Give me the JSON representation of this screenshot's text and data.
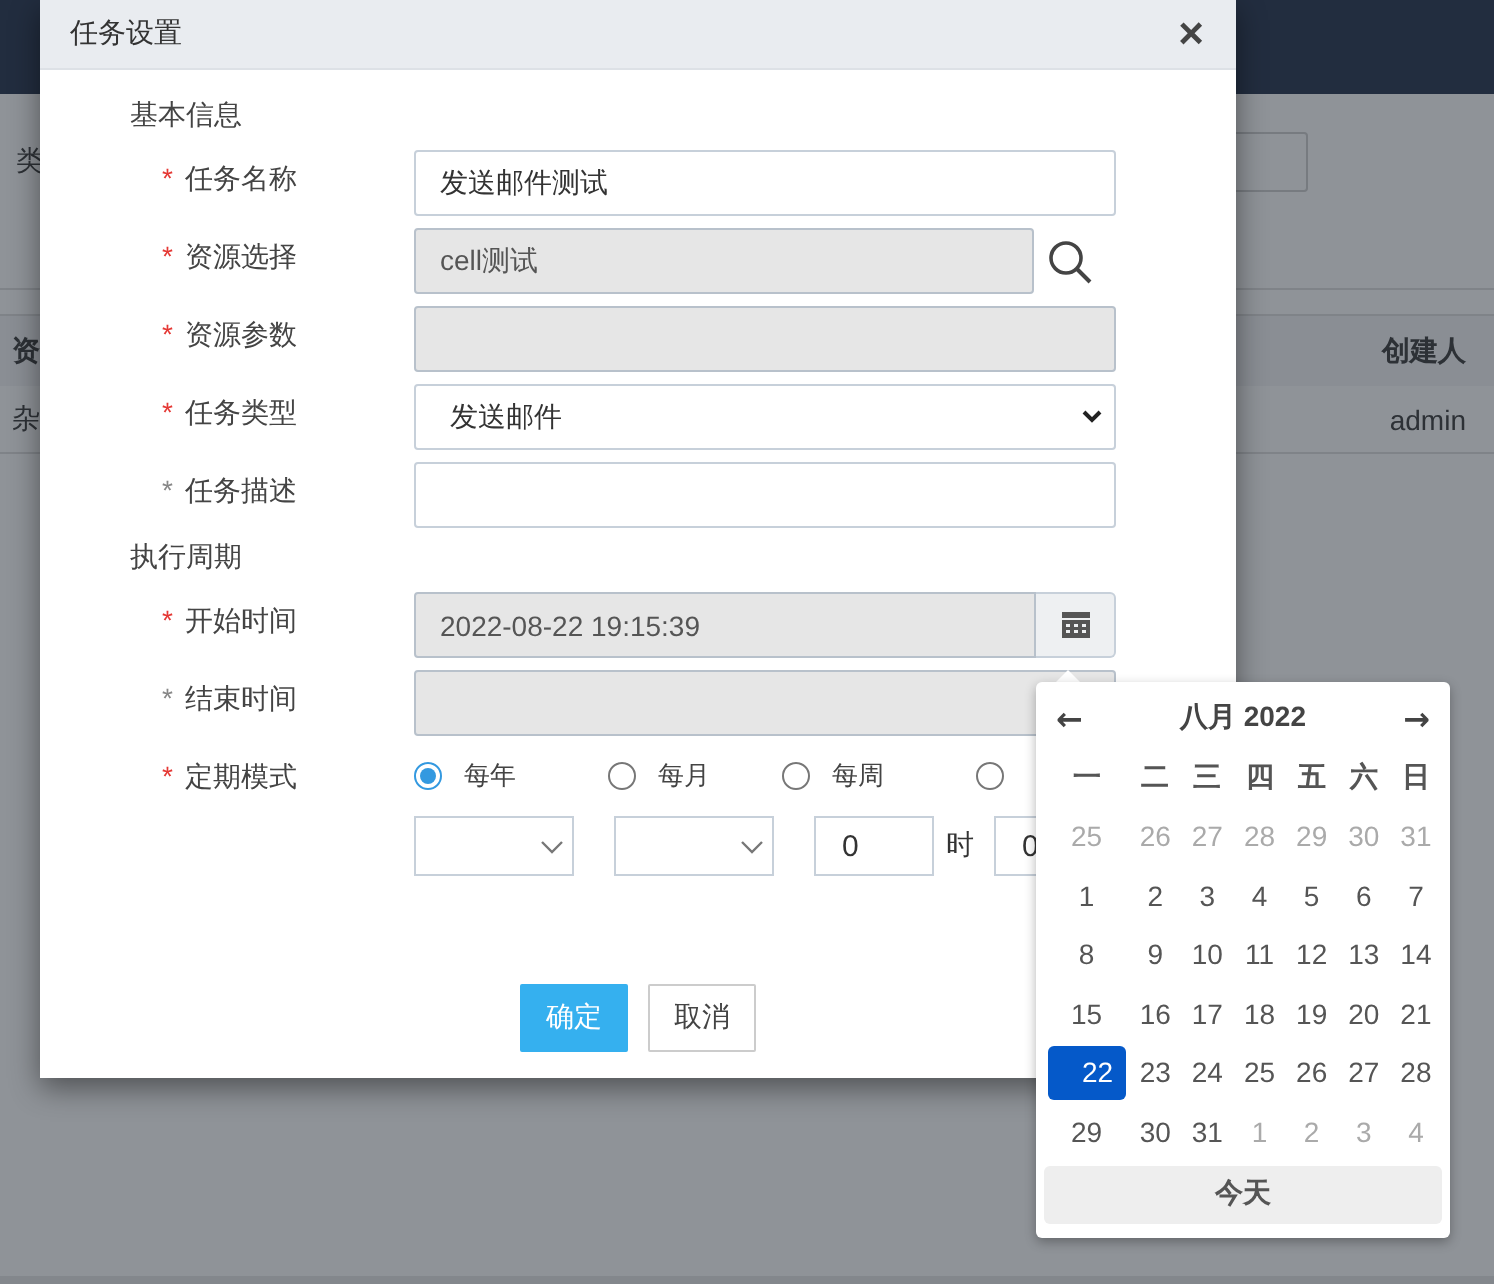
{
  "background_page": {
    "filter_labels": [
      "类"
    ],
    "table": {
      "columns": [
        "资",
        "创建人"
      ],
      "rows": [
        [
          "杂",
          "admin"
        ]
      ]
    }
  },
  "dialog": {
    "title": "任务设置",
    "close": "×",
    "sections": [
      {
        "title": "基本信息",
        "fields": [
          {
            "marker": "*",
            "label": "任务名称",
            "required": true,
            "kind": "text",
            "value": "发送邮件测试",
            "disabled": false
          },
          {
            "marker": "*",
            "label": "资源选择",
            "required": true,
            "kind": "lookup",
            "value": "cell测试",
            "disabled": true
          },
          {
            "marker": "*",
            "label": "资源参数",
            "required": true,
            "kind": "text",
            "disabled": true
          },
          {
            "marker": "*",
            "label": "任务类型",
            "required": true,
            "kind": "select",
            "value": "发送邮件",
            "disabled": false
          },
          {
            "marker": "*",
            "label": "任务描述",
            "required": false,
            "kind": "text",
            "disabled": false
          }
        ]
      },
      {
        "title": "执行周期",
        "fields": [
          {
            "marker": "*",
            "label": "开始时间",
            "required": true,
            "kind": "date",
            "value": "2022-08-22 19:15:39",
            "disabled": true
          },
          {
            "marker": "*",
            "label": "结束时间",
            "required": false,
            "kind": "text",
            "disabled": true
          },
          {
            "marker": "*",
            "label": "定期模式",
            "required": true,
            "kind": "radio",
            "options": [
              {
                "label": "每年",
                "selected": true
              },
              {
                "label": "每月",
                "selected": false
              },
              {
                "label": "每周",
                "selected": false
              },
              {
                "selected": false
              }
            ]
          }
        ]
      }
    ],
    "schedule": {
      "hour": "0",
      "hour_unit": "时",
      "minute": "0"
    },
    "buttons": [
      {
        "label": "确定",
        "primary": true
      },
      {
        "label": "取消",
        "primary": false
      }
    ]
  },
  "calendar": {
    "prev": "←",
    "title": "八月 2022",
    "next": "→",
    "weekdays": [
      "一",
      "二",
      "三",
      "四",
      "五",
      "六",
      "日"
    ],
    "weeks": [
      [
        {
          "day": "25",
          "muted": true,
          "selected": false
        },
        {
          "day": "26",
          "muted": true,
          "selected": false
        },
        {
          "day": "27",
          "muted": true,
          "selected": false
        },
        {
          "day": "28",
          "muted": true,
          "selected": false
        },
        {
          "day": "29",
          "muted": true,
          "selected": false
        },
        {
          "day": "30",
          "muted": true,
          "selected": false
        },
        {
          "day": "31",
          "muted": true,
          "selected": false
        }
      ],
      [
        {
          "day": "1",
          "muted": false,
          "selected": false
        },
        {
          "day": "2",
          "muted": false,
          "selected": false
        },
        {
          "day": "3",
          "muted": false,
          "selected": false
        },
        {
          "day": "4",
          "muted": false,
          "selected": false
        },
        {
          "day": "5",
          "muted": false,
          "selected": false
        },
        {
          "day": "6",
          "muted": false,
          "selected": false
        },
        {
          "day": "7",
          "muted": false,
          "selected": false
        }
      ],
      [
        {
          "day": "8",
          "muted": false,
          "selected": false
        },
        {
          "day": "9",
          "muted": false,
          "selected": false
        },
        {
          "day": "10",
          "muted": false,
          "selected": false
        },
        {
          "day": "11",
          "muted": false,
          "selected": false
        },
        {
          "day": "12",
          "muted": false,
          "selected": false
        },
        {
          "day": "13",
          "muted": false,
          "selected": false
        },
        {
          "day": "14",
          "muted": false,
          "selected": false
        }
      ],
      [
        {
          "day": "15",
          "muted": false,
          "selected": false
        },
        {
          "day": "16",
          "muted": false,
          "selected": false
        },
        {
          "day": "17",
          "muted": false,
          "selected": false
        },
        {
          "day": "18",
          "muted": false,
          "selected": false
        },
        {
          "day": "19",
          "muted": false,
          "selected": false
        },
        {
          "day": "20",
          "muted": false,
          "selected": false
        },
        {
          "day": "21",
          "muted": false,
          "selected": false
        }
      ],
      [
        {
          "day": "22",
          "muted": false,
          "selected": true
        },
        {
          "day": "23",
          "muted": false,
          "selected": false
        },
        {
          "day": "24",
          "muted": false,
          "selected": false
        },
        {
          "day": "25",
          "muted": false,
          "selected": false
        },
        {
          "day": "26",
          "muted": false,
          "selected": false
        },
        {
          "day": "27",
          "muted": false,
          "selected": false
        },
        {
          "day": "28",
          "muted": false,
          "selected": false
        }
      ],
      [
        {
          "day": "29",
          "muted": false,
          "selected": false
        },
        {
          "day": "30",
          "muted": false,
          "selected": false
        },
        {
          "day": "31",
          "muted": false,
          "selected": false
        },
        {
          "day": "1",
          "muted": true,
          "selected": false
        },
        {
          "day": "2",
          "muted": true,
          "selected": false
        },
        {
          "day": "3",
          "muted": true,
          "selected": false
        },
        {
          "day": "4",
          "muted": true,
          "selected": false
        }
      ]
    ],
    "today": "今天"
  }
}
